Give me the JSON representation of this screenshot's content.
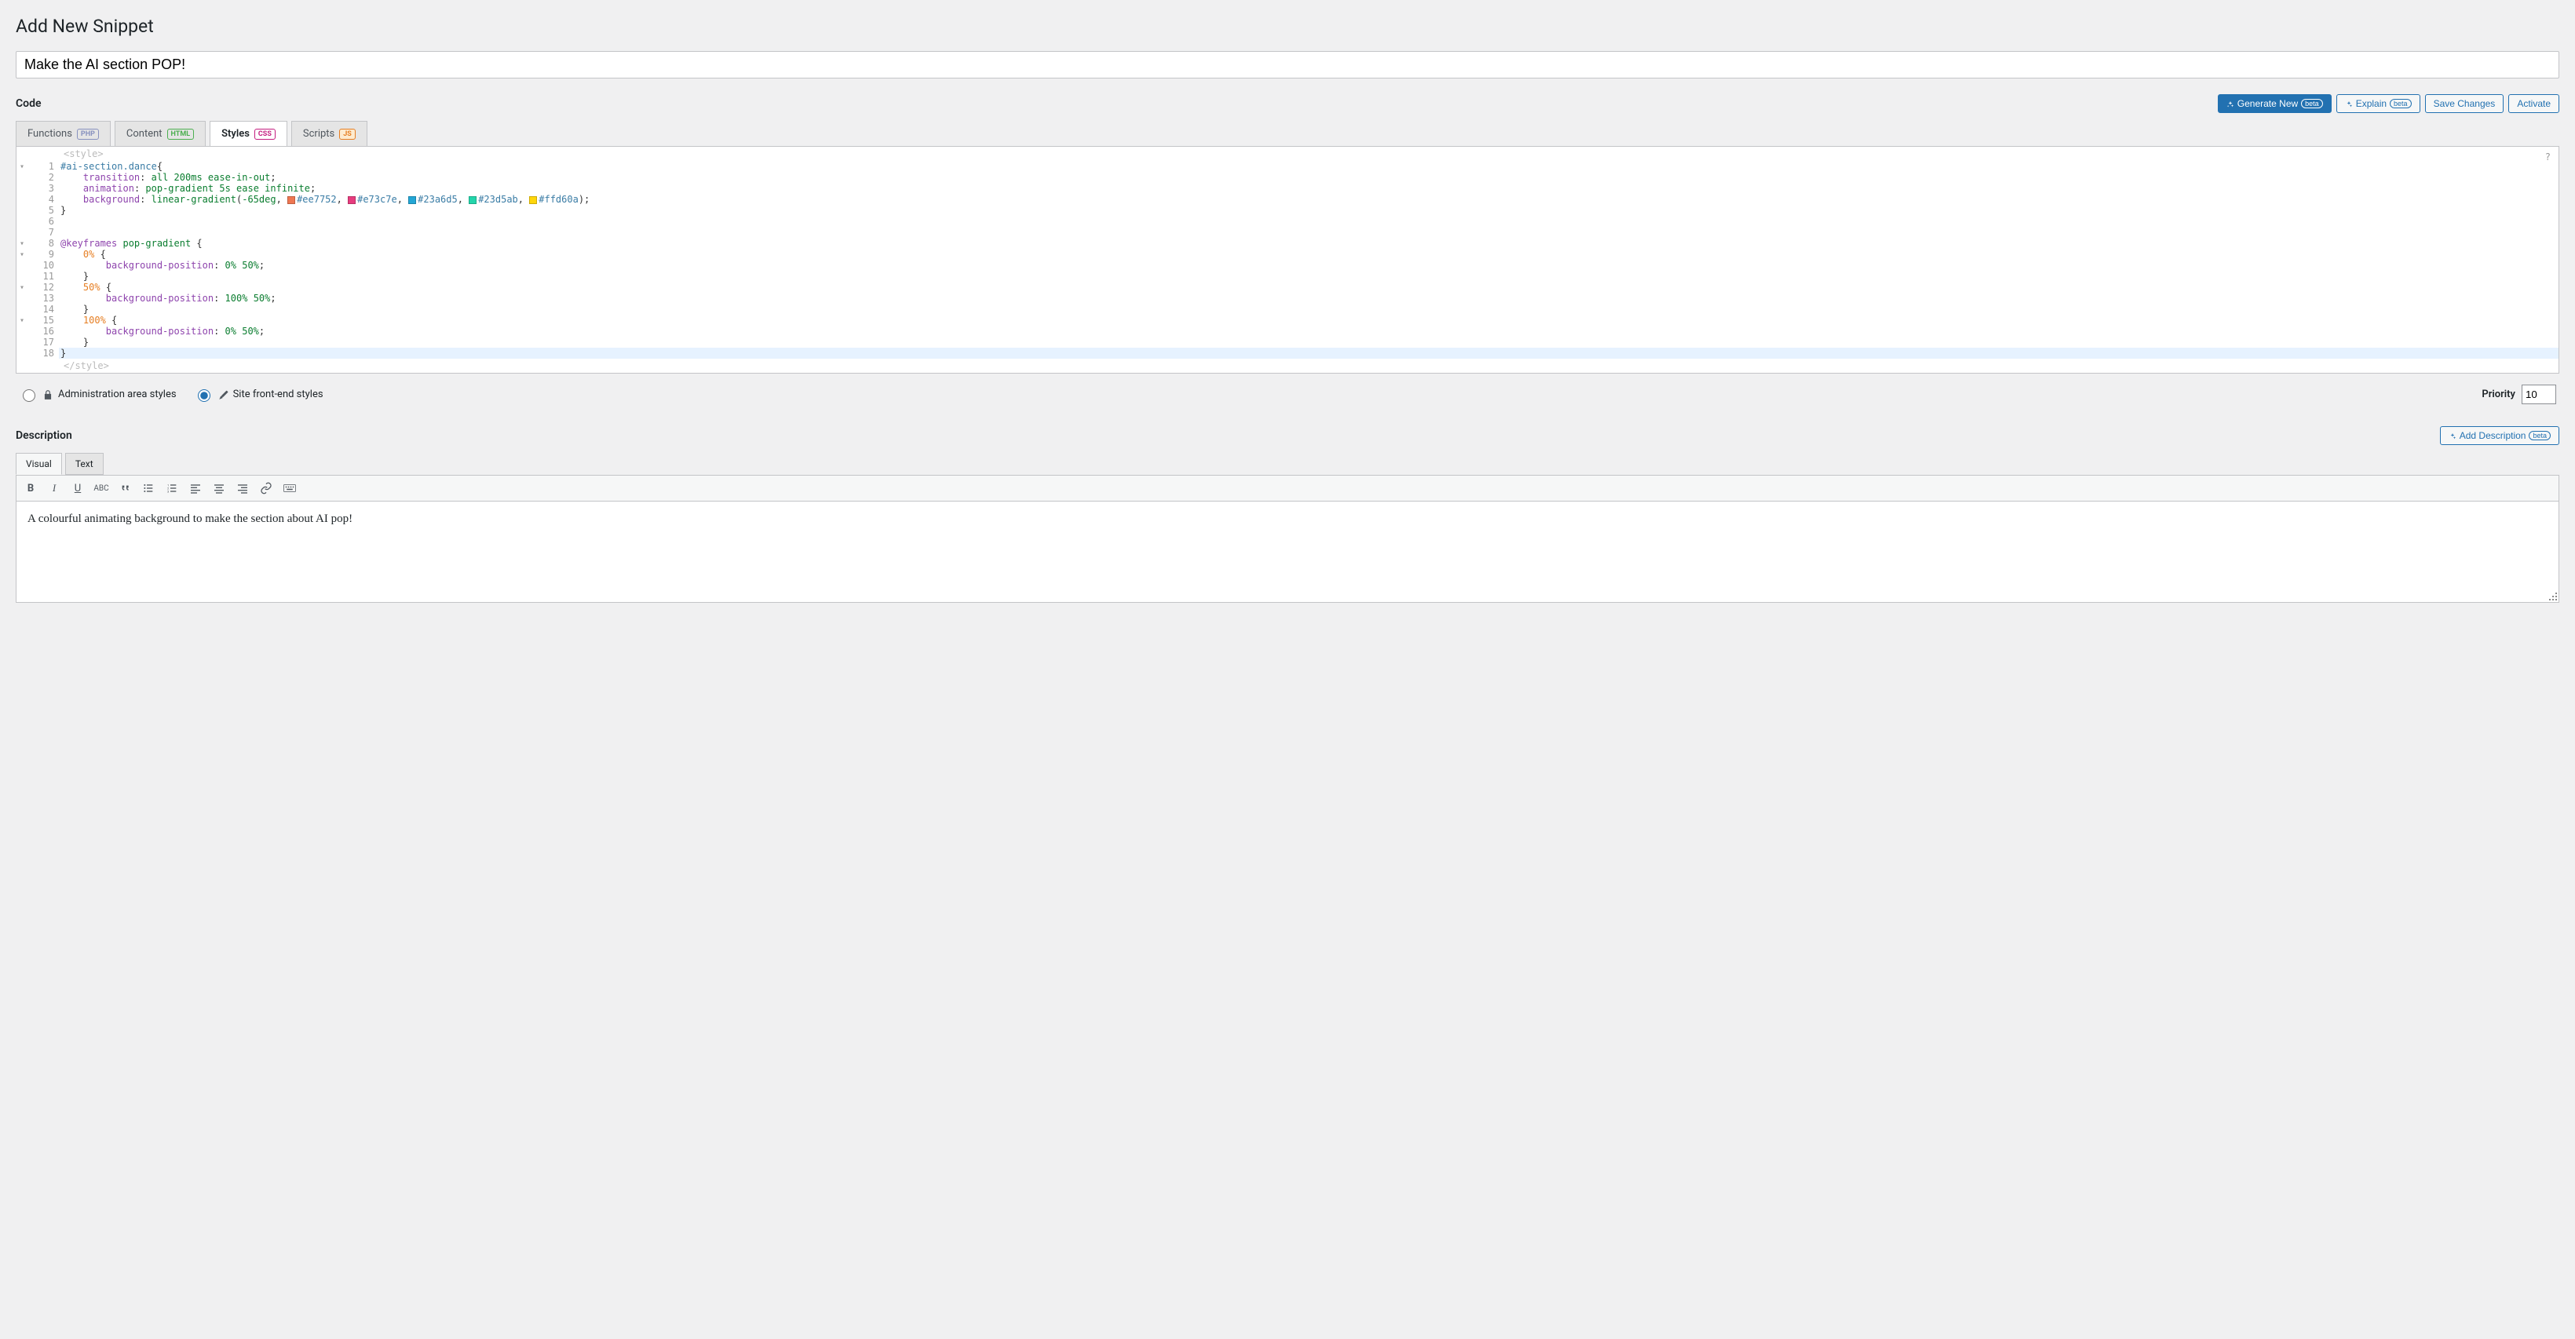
{
  "page": {
    "title": "Add New Snippet"
  },
  "title_input": {
    "value": "Make the AI section POP!"
  },
  "code": {
    "section_label": "Code",
    "buttons": {
      "generate_new": "Generate New",
      "generate_new_badge": "beta",
      "explain": "Explain",
      "explain_badge": "beta",
      "save": "Save Changes",
      "activate": "Activate"
    },
    "tabs": {
      "functions": {
        "label": "Functions",
        "lang": "PHP"
      },
      "content": {
        "label": "Content",
        "lang": "HTML"
      },
      "styles": {
        "label": "Styles",
        "lang": "CSS",
        "active": true
      },
      "scripts": {
        "label": "Scripts",
        "lang": "JS"
      }
    },
    "help_char": "?",
    "open_tag": "<style>",
    "close_tag": "</style>",
    "colors": {
      "c1": "#ee7752",
      "c2": "#e73c7e",
      "c3": "#23a6d5",
      "c4": "#23d5ab",
      "c5": "#ffd60a"
    },
    "lines": [
      {
        "n": 1,
        "fold": true
      },
      {
        "n": 2
      },
      {
        "n": 3
      },
      {
        "n": 4
      },
      {
        "n": 5
      },
      {
        "n": 6
      },
      {
        "n": 7
      },
      {
        "n": 8,
        "fold": true
      },
      {
        "n": 9,
        "fold": true
      },
      {
        "n": 10
      },
      {
        "n": 11
      },
      {
        "n": 12,
        "fold": true
      },
      {
        "n": 13
      },
      {
        "n": 14
      },
      {
        "n": 15,
        "fold": true
      },
      {
        "n": 16
      },
      {
        "n": 17
      },
      {
        "n": 18,
        "hl": true
      }
    ],
    "source": "#ai-section.dance{\n    transition: all 200ms ease-in-out;\n    animation: pop-gradient 5s ease infinite;\n    background: linear-gradient(-65deg, #ee7752, #e73c7e, #23a6d5, #23d5ab, #ffd60a);\n}\n\n\n@keyframes pop-gradient {\n    0% {\n        background-position: 0% 50%;\n    }\n    50% {\n        background-position: 100% 50%;\n    }\n    100% {\n        background-position: 0% 50%;\n    }\n}"
  },
  "scope": {
    "admin": "Administration area styles",
    "front": "Site front-end styles"
  },
  "priority": {
    "label": "Priority",
    "value": "10"
  },
  "description": {
    "section_label": "Description",
    "add_button": "Add Description",
    "add_button_badge": "beta",
    "tabs": {
      "visual": "Visual",
      "text": "Text"
    },
    "content": "A colourful animating background to make the section about AI pop!"
  }
}
